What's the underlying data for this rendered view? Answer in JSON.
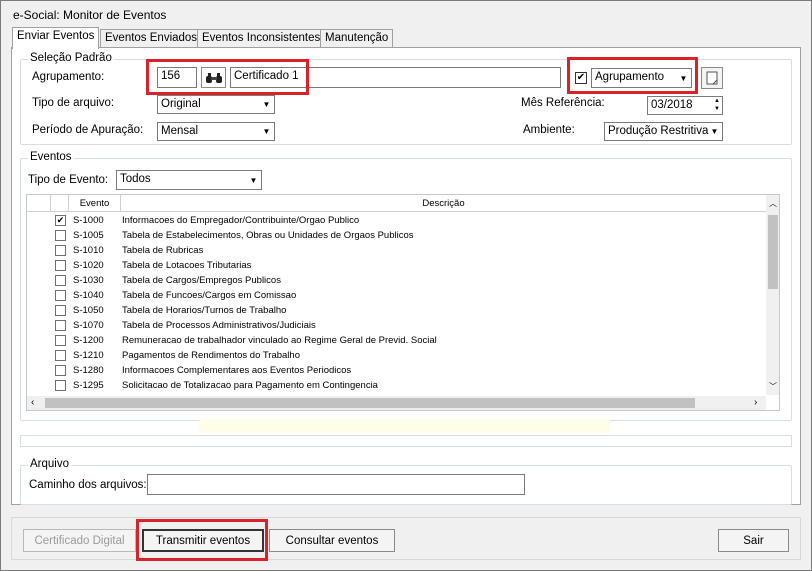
{
  "window": {
    "title": "e-Social: Monitor de Eventos"
  },
  "tabs": [
    {
      "label": "Enviar Eventos"
    },
    {
      "label": "Eventos Enviados"
    },
    {
      "label": "Eventos Inconsistentes"
    },
    {
      "label": "Manutenção"
    }
  ],
  "selecao": {
    "title": "Seleção Padrão",
    "agrupamento_label": "Agrupamento:",
    "agrupamento_code": "156",
    "agrupamento_name": "Certificado 1",
    "agrupamento_combo": "Agrupamento",
    "tipo_arquivo_label": "Tipo de arquivo:",
    "tipo_arquivo_value": "Original",
    "periodo_label": "Período de Apuração:",
    "periodo_value": "Mensal",
    "mes_label": "Mês Referência:",
    "mes_value": "03/2018",
    "ambiente_label": "Ambiente:",
    "ambiente_value": "Produção Restritiva"
  },
  "eventos": {
    "title": "Eventos",
    "tipo_label": "Tipo de Evento:",
    "tipo_value": "Todos",
    "col_evento": "Evento",
    "col_descricao": "Descrição",
    "rows": [
      {
        "code": "S-1000",
        "desc": "Informacoes do Empregador/Contribuinte/Orgao Publico",
        "checked": "✔"
      },
      {
        "code": "S-1005",
        "desc": "Tabela de Estabelecimentos, Obras ou Unidades de Orgaos Publicos",
        "checked": ""
      },
      {
        "code": "S-1010",
        "desc": "Tabela de Rubricas",
        "checked": ""
      },
      {
        "code": "S-1020",
        "desc": "Tabela de Lotacoes Tributarias",
        "checked": ""
      },
      {
        "code": "S-1030",
        "desc": "Tabela de Cargos/Empregos Publicos",
        "checked": ""
      },
      {
        "code": "S-1040",
        "desc": "Tabela de Funcoes/Cargos em Comissao",
        "checked": ""
      },
      {
        "code": "S-1050",
        "desc": "Tabela de Horarios/Turnos de Trabalho",
        "checked": ""
      },
      {
        "code": "S-1070",
        "desc": "Tabela de Processos Administrativos/Judiciais",
        "checked": ""
      },
      {
        "code": "S-1200",
        "desc": "Remuneracao de trabalhador vinculado ao Regime Geral de Previd. Social",
        "checked": ""
      },
      {
        "code": "S-1210",
        "desc": "Pagamentos de Rendimentos do Trabalho",
        "checked": ""
      },
      {
        "code": "S-1280",
        "desc": "Informacoes Complementares aos Eventos Periodicos",
        "checked": ""
      },
      {
        "code": "S-1295",
        "desc": "Solicitacao de Totalizacao para Pagamento em Contingencia",
        "checked": ""
      }
    ]
  },
  "arquivo": {
    "title": "Arquivo",
    "caminho_label": "Caminho dos arquivos:",
    "caminho_value": ""
  },
  "buttons": {
    "certificado": "Certificado Digital",
    "transmitir": "Transmitir eventos",
    "consultar": "Consultar eventos",
    "sair": "Sair"
  },
  "colors": {
    "highlight_red": "#d9232b",
    "scrollbar": "#c1c1c1"
  },
  "icons": {
    "search": "binoculars-icon",
    "notes": "document-icon"
  }
}
